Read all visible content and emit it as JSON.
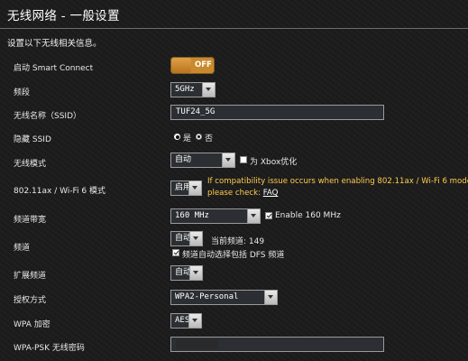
{
  "header": {
    "title": "无线网络 - 一般设置",
    "subtitle": "设置以下无线相关信息。"
  },
  "form": {
    "smart_connect": {
      "label": "启动 Smart Connect",
      "state": "OFF"
    },
    "band": {
      "label": "频段",
      "value": "5GHz"
    },
    "ssid": {
      "label": "无线名称（SSID）",
      "value": "TUF24_5G"
    },
    "hide_ssid": {
      "label": "隐藏 SSID",
      "yes": "是",
      "no": "否",
      "selected": "否"
    },
    "wireless_mode": {
      "label": "无线模式",
      "value": "自动",
      "checkbox_label": "为 Xbox优化",
      "checked": false
    },
    "ax_mode": {
      "label": "802.11ax / Wi-Fi 6 模式",
      "value": "启用",
      "warning_line1": "If compatibility issue occurs when enabling 802.11ax / Wi-Fi 6 mode,",
      "warning_line2": "please check: ",
      "faq_link": "FAQ"
    },
    "bandwidth": {
      "label": "频道带宽",
      "value": "160 MHz",
      "checkbox_label": "Enable 160 MHz",
      "checked": true
    },
    "channel": {
      "label": "频道",
      "value": "自动",
      "current_channel": "当前频道: 149",
      "dfs_label": "频道自动选择包括 DFS 频道",
      "dfs_checked": true
    },
    "ext_channel": {
      "label": "扩展频道",
      "value": "自动"
    },
    "auth": {
      "label": "授权方式",
      "value": "WPA2-Personal"
    },
    "wpa_encryption": {
      "label": "WPA 加密",
      "value": "AES"
    },
    "wpa_psk": {
      "label": "WPA-PSK 无线密码",
      "value": ""
    }
  },
  "colors": {
    "background": "#1c1c1c",
    "toggle_off": "#c98a2e",
    "warning": "#ffcc4d"
  }
}
